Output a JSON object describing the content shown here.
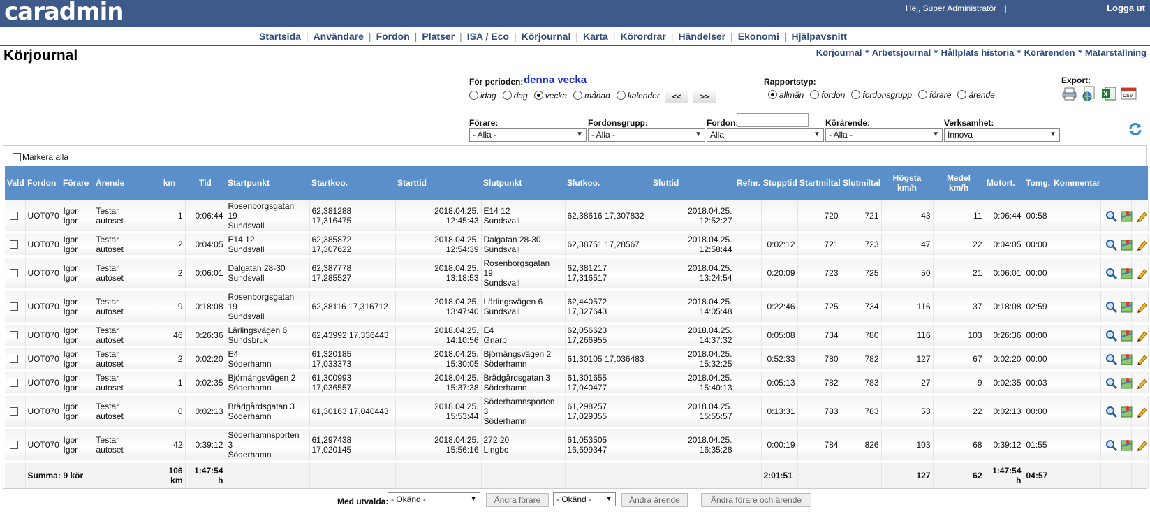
{
  "header": {
    "logo": "caradmin",
    "greeting": "Hej, Super Administratör",
    "separator": "|",
    "logout": "Logga ut"
  },
  "nav": [
    "Startsida",
    "Användare",
    "Fordon",
    "Platser",
    "ISA / Eco",
    "Körjournal",
    "Karta",
    "Körordrar",
    "Händelser",
    "Ekonomi",
    "Hjälpavsnitt"
  ],
  "page_title": "Körjournal",
  "subnav": [
    "Körjournal",
    "Arbetsjournal",
    "Hållplats historia",
    "Körärenden",
    "Mätarställning"
  ],
  "period": {
    "label": "För perioden:",
    "value": "denna vecka",
    "options": [
      "idag",
      "dag",
      "vecka",
      "månad",
      "kalender"
    ],
    "selected": "vecka",
    "prev": "<<",
    "next": ">>"
  },
  "rapport": {
    "label": "Rapportstyp:",
    "options": [
      "allmän",
      "fordon",
      "fordonsgrupp",
      "förare",
      "ärende"
    ],
    "selected": "allmän"
  },
  "export": {
    "label": "Export:",
    "icons": [
      "print-icon",
      "web-export-icon",
      "excel-icon",
      "csv-icon"
    ]
  },
  "filters": {
    "forare": {
      "label": "Förare:",
      "value": "- Alla -"
    },
    "fordonsgrupp": {
      "label": "Fordonsgrupp:",
      "value": "- Alla -"
    },
    "fordon": {
      "label": "Fordon:",
      "value": "Alla",
      "input": ""
    },
    "korarende": {
      "label": "Körärende:",
      "value": "- Alla -"
    },
    "verksamhet": {
      "label": "Verksamhet:",
      "value": "Innova"
    }
  },
  "mark_all": "Markera alla",
  "columns": [
    "Vald",
    "Fordon",
    "Förare",
    "Ärende",
    "km",
    "Tid",
    "Startpunkt",
    "Startkoo.",
    "Starttid",
    "Slutpunkt",
    "Slutkoo.",
    "Sluttid",
    "Refnr.",
    "Stopptid",
    "Startmiltal",
    "Slutmiltal",
    "Högsta\nkm/h",
    "Medel\nkm/h",
    "Motort.",
    "Tomg.",
    "Kommentar",
    "",
    "",
    ""
  ],
  "rows": [
    {
      "fordon": "UOT070",
      "forare": "Igor\nIgor",
      "arende": "Testar\nautoset",
      "km": "1",
      "tid": "0:06:44",
      "startpunkt": "Rosenborgsgatan\n19\nSundsvall",
      "startkoo": "62,381288\n17,316475",
      "starttid": "2018.04.25.\n12:45:43",
      "slutpunkt": "E14 12\nSundsvall",
      "slutkoo": "62,38616 17,307832",
      "sluttid": "2018.04.25.\n12:52:27",
      "refnr": "",
      "stopptid": "",
      "startmiltal": "720",
      "slutmiltal": "721",
      "hogsta": "43",
      "medel": "11",
      "motort": "0:06:44",
      "tomg": "00:58"
    },
    {
      "fordon": "UOT070",
      "forare": "Igor\nIgor",
      "arende": "Testar\nautoset",
      "km": "2",
      "tid": "0:04:05",
      "startpunkt": "E14 12\nSundsvall",
      "startkoo": "62,385872\n17,307622",
      "starttid": "2018.04.25.\n12:54:39",
      "slutpunkt": "Dalgatan 28-30\nSundsvall",
      "slutkoo": "62,38751 17,28567",
      "sluttid": "2018.04.25.\n12:58:44",
      "refnr": "",
      "stopptid": "0:02:12",
      "startmiltal": "721",
      "slutmiltal": "723",
      "hogsta": "47",
      "medel": "22",
      "motort": "0:04:05",
      "tomg": "00:00"
    },
    {
      "fordon": "UOT070",
      "forare": "Igor\nIgor",
      "arende": "Testar\nautoset",
      "km": "2",
      "tid": "0:06:01",
      "startpunkt": "Dalgatan 28-30\nSundsvall",
      "startkoo": "62,387778\n17,285527",
      "starttid": "2018.04.25.\n13:18:53",
      "slutpunkt": "Rosenborgsgatan\n19\nSundsvall",
      "slutkoo": "62,381217\n17,316517",
      "sluttid": "2018.04.25.\n13:24:54",
      "refnr": "",
      "stopptid": "0:20:09",
      "startmiltal": "723",
      "slutmiltal": "725",
      "hogsta": "50",
      "medel": "21",
      "motort": "0:06:01",
      "tomg": "00:00"
    },
    {
      "fordon": "UOT070",
      "forare": "Igor\nIgor",
      "arende": "Testar\nautoset",
      "km": "9",
      "tid": "0:18:08",
      "startpunkt": "Rosenborgsgatan\n19\nSundsvall",
      "startkoo": "62,38116 17,316712",
      "starttid": "2018.04.25.\n13:47:40",
      "slutpunkt": "Lärlingsvägen 6\nSundsvall",
      "slutkoo": "62,440572\n17,327643",
      "sluttid": "2018.04.25.\n14:05:48",
      "refnr": "",
      "stopptid": "0:22:46",
      "startmiltal": "725",
      "slutmiltal": "734",
      "hogsta": "116",
      "medel": "37",
      "motort": "0:18:08",
      "tomg": "02:59"
    },
    {
      "fordon": "UOT070",
      "forare": "Igor\nIgor",
      "arende": "Testar\nautoset",
      "km": "46",
      "tid": "0:26:36",
      "startpunkt": "Lärlingsvägen 6\nSundsbruk",
      "startkoo": "62,43992 17,336443",
      "starttid": "2018.04.25.\n14:10:56",
      "slutpunkt": "E4\nGnarp",
      "slutkoo": "62,056623\n17,266955",
      "sluttid": "2018.04.25.\n14:37:32",
      "refnr": "",
      "stopptid": "0:05:08",
      "startmiltal": "734",
      "slutmiltal": "780",
      "hogsta": "116",
      "medel": "103",
      "motort": "0:26:36",
      "tomg": "00:00"
    },
    {
      "fordon": "UOT070",
      "forare": "Igor\nIgor",
      "arende": "Testar\nautoset",
      "km": "2",
      "tid": "0:02:20",
      "startpunkt": "E4\nSöderhamn",
      "startkoo": "61,320185\n17,033373",
      "starttid": "2018.04.25.\n15:30:05",
      "slutpunkt": "Björnängsvägen 2\nSöderhamn",
      "slutkoo": "61,30105 17,036483",
      "sluttid": "2018.04.25.\n15:32:25",
      "refnr": "",
      "stopptid": "0:52:33",
      "startmiltal": "780",
      "slutmiltal": "782",
      "hogsta": "127",
      "medel": "67",
      "motort": "0:02:20",
      "tomg": "00:00"
    },
    {
      "fordon": "UOT070",
      "forare": "Igor\nIgor",
      "arende": "Testar\nautoset",
      "km": "1",
      "tid": "0:02:35",
      "startpunkt": "Björnängsvägen 2\nSöderhamn",
      "startkoo": "61,300993\n17,036557",
      "starttid": "2018.04.25.\n15:37:38",
      "slutpunkt": "Brädgårdsgatan 3\nSöderhamn",
      "slutkoo": "61,301655\n17,040477",
      "sluttid": "2018.04.25.\n15:40:13",
      "refnr": "",
      "stopptid": "0:05:13",
      "startmiltal": "782",
      "slutmiltal": "783",
      "hogsta": "27",
      "medel": "9",
      "motort": "0:02:35",
      "tomg": "00:03"
    },
    {
      "fordon": "UOT070",
      "forare": "Igor\nIgor",
      "arende": "Testar\nautoset",
      "km": "0",
      "tid": "0:02:13",
      "startpunkt": "Brädgårdsgatan 3\nSöderhamn",
      "startkoo": "61,30163 17,040443",
      "starttid": "2018.04.25.\n15:53:44",
      "slutpunkt": "Söderhamnsporten\n3\nSöderhamn",
      "slutkoo": "61,298257\n17,029355",
      "sluttid": "2018.04.25.\n15:55:57",
      "refnr": "",
      "stopptid": "0:13:31",
      "startmiltal": "783",
      "slutmiltal": "783",
      "hogsta": "53",
      "medel": "22",
      "motort": "0:02:13",
      "tomg": "00:00"
    },
    {
      "fordon": "UOT070",
      "forare": "Igor\nIgor",
      "arende": "Testar\nautoset",
      "km": "42",
      "tid": "0:39:12",
      "startpunkt": "Söderhamnsporten\n3\nSöderhamn",
      "startkoo": "61,297438\n17,020145",
      "starttid": "2018.04.25.\n15:56:16",
      "slutpunkt": "272 20\nLingbo",
      "slutkoo": "61,053505\n16,699347",
      "sluttid": "2018.04.25.\n16:35:28",
      "refnr": "",
      "stopptid": "0:00:19",
      "startmiltal": "784",
      "slutmiltal": "826",
      "hogsta": "103",
      "medel": "68",
      "motort": "0:39:12",
      "tomg": "01:55"
    }
  ],
  "summary": {
    "label": "Summa:",
    "trips": "9 kör",
    "km": "106\nkm",
    "tid": "1:47:54\nh",
    "stopptid": "2:01:51",
    "hogsta": "127",
    "medel": "62",
    "motort": "1:47:54\nh",
    "tomg": "04:57"
  },
  "bottom": {
    "label": "Med utvalda:",
    "select1": "- Okänd -",
    "btn1": "Ändra förare",
    "select2": "- Okänd -",
    "btn2": "Ändra ärende",
    "btn3": "Ändra förare och ärende"
  }
}
